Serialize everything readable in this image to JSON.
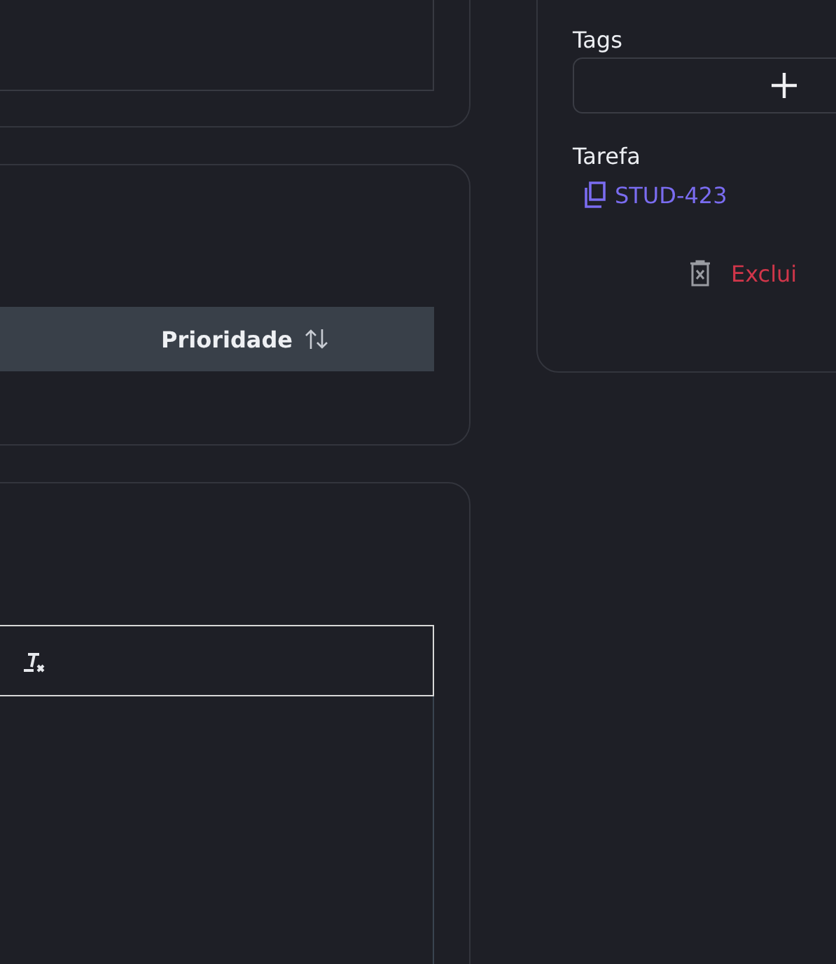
{
  "table": {
    "columns": [
      {
        "label": "Prioridade",
        "sortable": true
      }
    ]
  },
  "editor": {
    "toolbar": [
      {
        "kind": "clear-format"
      }
    ]
  },
  "sidebar": {
    "tags": {
      "label": "Tags"
    },
    "task": {
      "label": "Tarefa",
      "link": "STUD-423"
    },
    "delete_button": "Exclui"
  }
}
